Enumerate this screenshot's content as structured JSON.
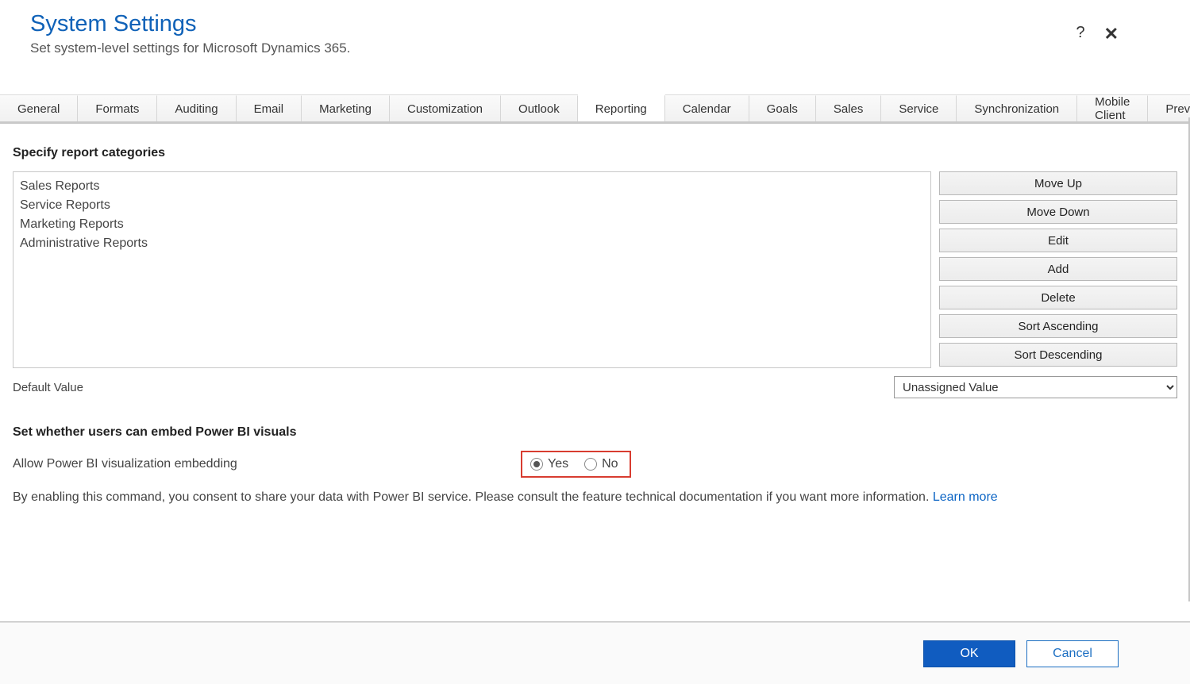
{
  "header": {
    "title": "System Settings",
    "subtitle": "Set system-level settings for Microsoft Dynamics 365.",
    "help_icon": "?",
    "close_icon": "✕"
  },
  "tabs": [
    {
      "label": "General",
      "active": false
    },
    {
      "label": "Formats",
      "active": false
    },
    {
      "label": "Auditing",
      "active": false
    },
    {
      "label": "Email",
      "active": false
    },
    {
      "label": "Marketing",
      "active": false
    },
    {
      "label": "Customization",
      "active": false
    },
    {
      "label": "Outlook",
      "active": false
    },
    {
      "label": "Reporting",
      "active": true
    },
    {
      "label": "Calendar",
      "active": false
    },
    {
      "label": "Goals",
      "active": false
    },
    {
      "label": "Sales",
      "active": false
    },
    {
      "label": "Service",
      "active": false
    },
    {
      "label": "Synchronization",
      "active": false
    },
    {
      "label": "Mobile Client",
      "active": false
    },
    {
      "label": "Previews",
      "active": false
    }
  ],
  "report": {
    "section_title": "Specify report categories",
    "items": [
      "Sales Reports",
      "Service Reports",
      "Marketing Reports",
      "Administrative Reports"
    ],
    "buttons": {
      "move_up": "Move Up",
      "move_down": "Move Down",
      "edit": "Edit",
      "add": "Add",
      "delete": "Delete",
      "sort_asc": "Sort Ascending",
      "sort_desc": "Sort Descending"
    },
    "default_label": "Default Value",
    "default_value": "Unassigned Value"
  },
  "embed": {
    "section_title": "Set whether users can embed Power BI visuals",
    "label": "Allow Power BI visualization embedding",
    "option_yes": "Yes",
    "option_no": "No",
    "selected": "yes",
    "note_prefix": "By enabling this command, you consent to share your data with Power BI service. Please consult the feature technical documentation if you want more information. ",
    "learn_more": "Learn more"
  },
  "footer": {
    "ok": "OK",
    "cancel": "Cancel"
  }
}
